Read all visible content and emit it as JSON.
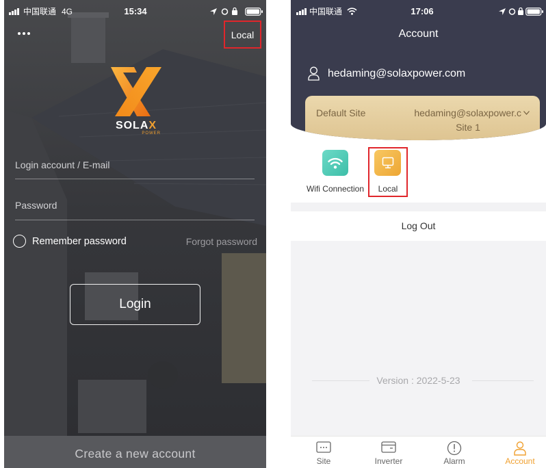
{
  "left_phone": {
    "status_bar": {
      "carrier": "中国联通",
      "network": "4G",
      "time": "15:34"
    },
    "menu_icon": "more-icon",
    "local_label": "Local",
    "logo": {
      "wordmark_main": "SOLA",
      "wordmark_accent": "X",
      "sub": "POWER"
    },
    "account_placeholder": "Login account / E-mail",
    "password_placeholder": "Password",
    "remember_label": "Remember password",
    "forgot_label": "Forgot password",
    "login_label": "Login",
    "create_account_label": "Create a new account"
  },
  "right_phone": {
    "status_bar": {
      "carrier": "中国联通",
      "time": "17:06"
    },
    "title": "Account",
    "user_email": "hedaming@solaxpower.com",
    "site_card": {
      "label": "Default Site",
      "account": "hedaming@solaxpower.c",
      "site_name": "Site 1"
    },
    "tools": [
      {
        "label": "Wifi Connection",
        "icon": "wifi-icon"
      },
      {
        "label": "Local",
        "icon": "monitor-icon"
      }
    ],
    "logout_label": "Log Out",
    "version": "Version : 2022-5-23",
    "tabs": [
      {
        "label": "Site",
        "icon": "site-icon",
        "active": false
      },
      {
        "label": "Inverter",
        "icon": "inverter-icon",
        "active": false
      },
      {
        "label": "Alarm",
        "icon": "alarm-icon",
        "active": false
      },
      {
        "label": "Account",
        "icon": "account-icon",
        "active": true
      }
    ]
  },
  "colors": {
    "accent_orange": "#f0a030",
    "header_navy": "#3a3c4e",
    "annotation_red": "#e0262b",
    "wifi_tile": "#4fc9b6",
    "local_tile": "#f0b443"
  }
}
